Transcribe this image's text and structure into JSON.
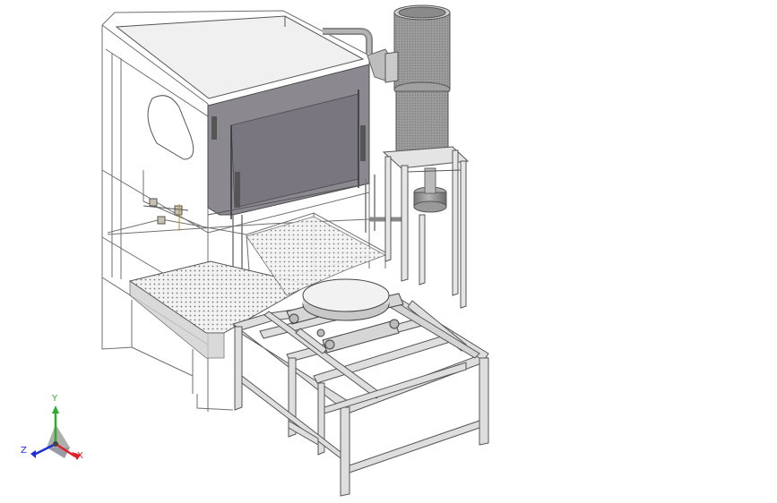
{
  "viewport": {
    "background": "#ffffff",
    "model_colors": {
      "frame_steel": "#d8d8d8",
      "frame_edge": "#555555",
      "glass_edge": "#6f6f6f",
      "panel_fill": "#8c8890",
      "duct_fill": "#9a9a9a",
      "turntable_fill": "#e8e8e8"
    }
  },
  "triad": {
    "x_label": "X",
    "y_label": "Y",
    "z_label": "Z",
    "x_color": "#e0202a",
    "y_color": "#2faa2f",
    "z_color": "#1f2fd8"
  }
}
